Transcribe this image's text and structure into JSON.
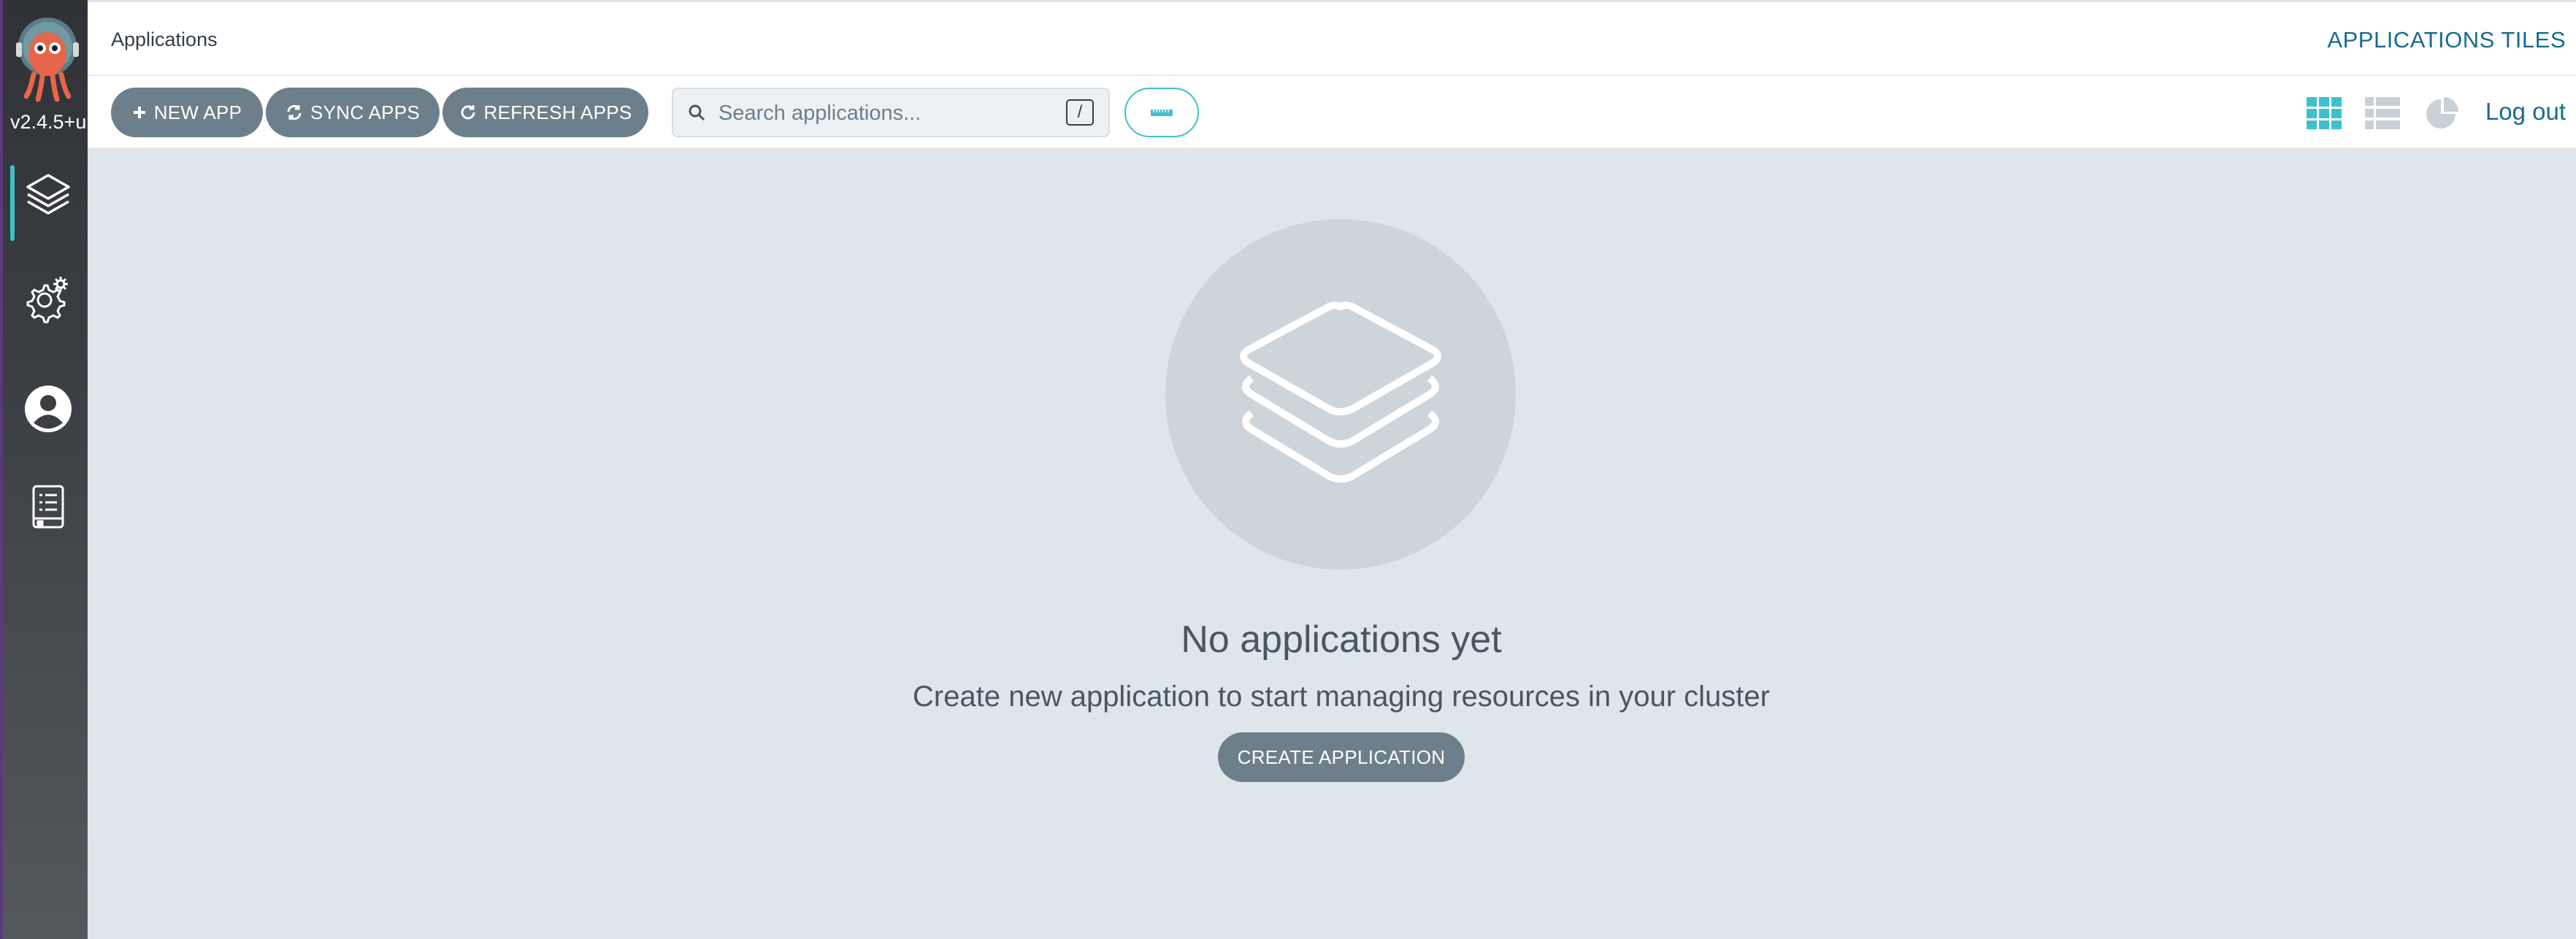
{
  "sidebar": {
    "version": "v2.4.5+u",
    "items": [
      {
        "icon": "layers-icon",
        "active": true
      },
      {
        "icon": "gear-icon",
        "active": false
      },
      {
        "icon": "user-icon",
        "active": false
      },
      {
        "icon": "docs-icon",
        "active": false
      }
    ]
  },
  "header": {
    "breadcrumb": "Applications",
    "title": "APPLICATIONS TILES"
  },
  "toolbar": {
    "new_app_label": "NEW APP",
    "sync_apps_label": "SYNC APPS",
    "refresh_apps_label": "REFRESH APPS",
    "search_placeholder": "Search applications...",
    "search_shortcut": "/",
    "logout_label": "Log out",
    "views": [
      "tiles-view-icon",
      "list-view-icon",
      "summary-pie-icon"
    ],
    "active_view": "tiles-view-icon"
  },
  "empty_state": {
    "title": "No applications yet",
    "subtitle": "Create new application to start managing resources in your cluster",
    "create_label": "CREATE APPLICATION"
  },
  "colors": {
    "accent": "#3ec0cd",
    "button": "#6d7f8b",
    "title": "#176b8f",
    "background": "#dee6eb"
  }
}
